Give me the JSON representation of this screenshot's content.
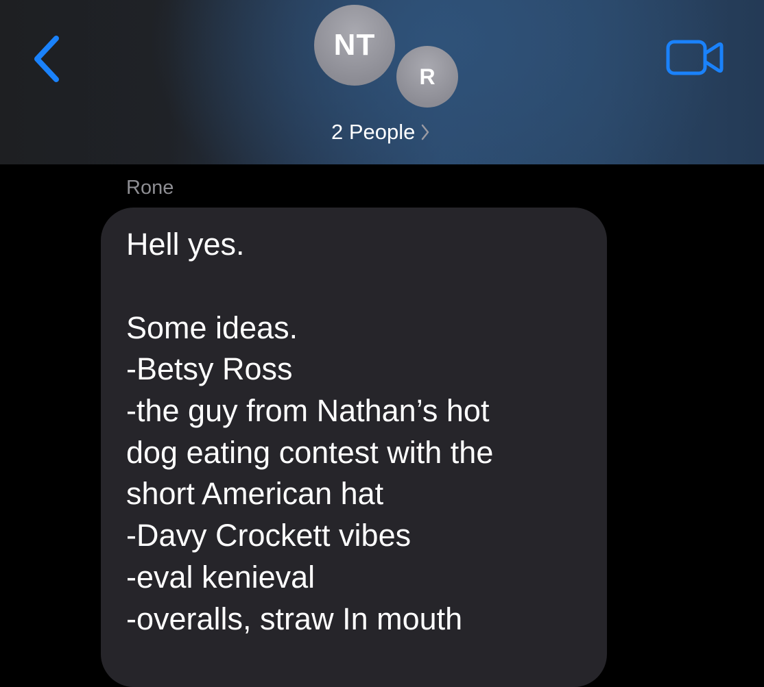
{
  "header": {
    "back_icon": "chevron-left-icon",
    "avatars": [
      {
        "initials": "NT"
      },
      {
        "initials": "R"
      }
    ],
    "group_label": "2 People",
    "group_chevron_icon": "chevron-right-icon",
    "video_icon": "video-camera-icon",
    "accent_color": "#1a82fb"
  },
  "conversation": {
    "sender": "Rone",
    "message_lines": [
      "Hell yes.",
      "",
      "Some ideas.",
      "-Betsy Ross",
      "-the guy from Nathan’s hot",
      "dog eating contest with the",
      "short American hat",
      "-Davy Crockett vibes",
      "-eval kenieval",
      "-overalls, straw In mouth"
    ],
    "bubble_color": "#26252a"
  }
}
